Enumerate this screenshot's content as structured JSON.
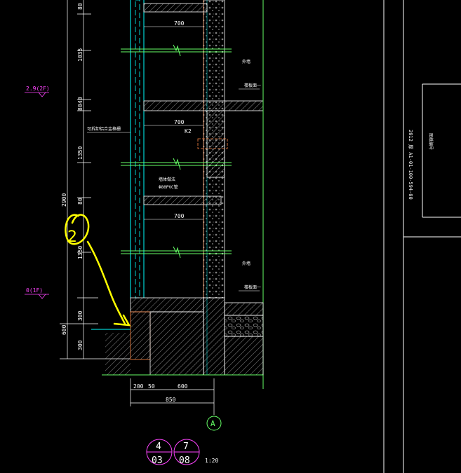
{
  "dims_left": {
    "d80_top": "80",
    "d1035": "1035",
    "d40": "40",
    "d80_mid": "80",
    "d1350_up": "1350",
    "d80_low": "80",
    "d1350_low": "1350",
    "d300_a": "300",
    "d300_b": "300",
    "d2900": "2900",
    "d600": "600"
  },
  "levels": {
    "l2f": "2.9(2F)",
    "l1f": "0(1F)"
  },
  "dims_bottom": {
    "d200": "200",
    "d50": "50",
    "d600": "600",
    "d850": "850"
  },
  "labels": {
    "d700_a": "700",
    "d700_b": "700",
    "d700_c": "700",
    "k2": "K2",
    "pvc": "Φ80PVC管",
    "note_a": "墙体做法",
    "note_b": "Φ80PVC管",
    "note_c": "外墙",
    "note_d": "楼板面一",
    "note_e": "外墙",
    "note_f": "楼板面一",
    "side_note": "可拆卸铝合金格栅"
  },
  "axis": {
    "bubble": "A"
  },
  "detail": {
    "ref1_top": "4",
    "ref1_bottom": "03",
    "ref2_top": "7",
    "ref2_bottom": "08",
    "scale": "1:20"
  },
  "title_block": {
    "code": "2012 厚 A1-01-100-594-00",
    "short": "图纸编号"
  },
  "markup": {
    "annotation": "2"
  }
}
